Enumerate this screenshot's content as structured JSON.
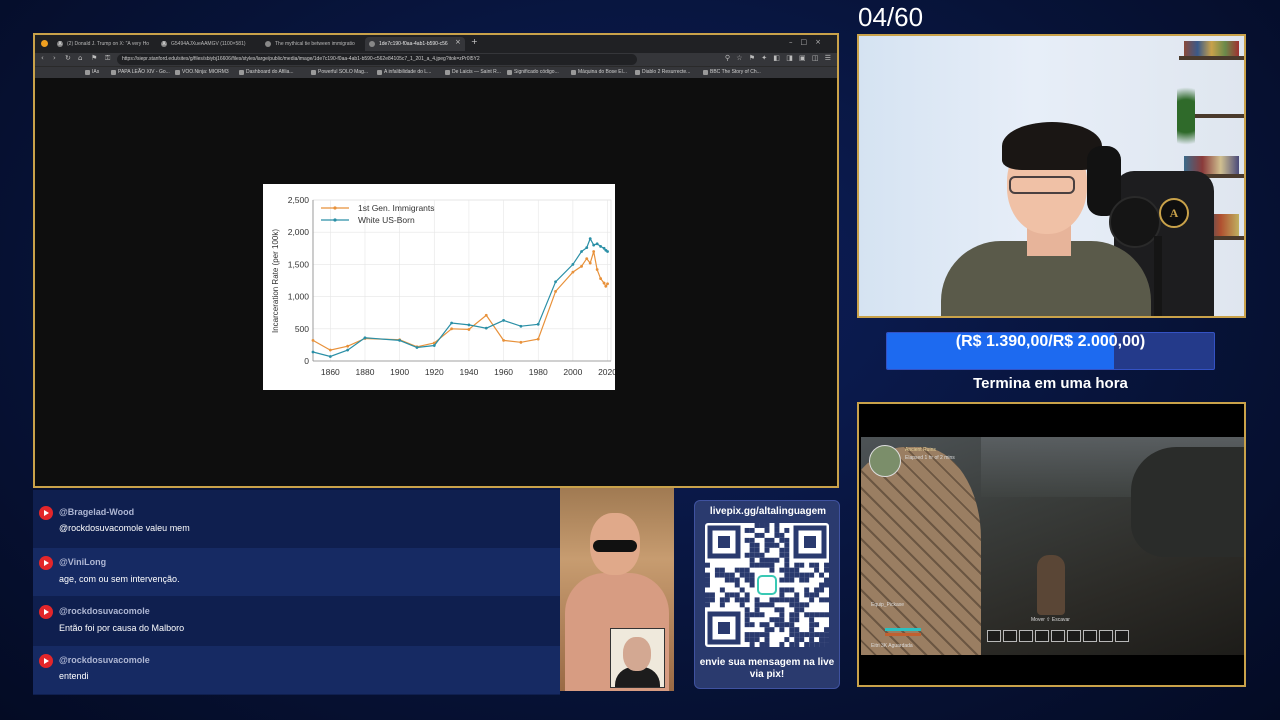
{
  "browser": {
    "tabs": [
      {
        "icon": "X",
        "label": "(2) Donald J. Trump on X: \"A very Ho"
      },
      {
        "icon": "X",
        "label": "G5494AJXueAAMGV (1100×581)"
      },
      {
        "icon": "",
        "label": "The mythical tie between immigratio"
      },
      {
        "icon": "",
        "label": "1de7c190-f0aa-4ab1-b590-c56"
      }
    ],
    "url": "https://siepr.stanford.edu/sites/g/files/sbiybj16606/files/styles/large/public/media/image/1de7c190-f0aa-4ab1-b590-c562e84105c7_1_201_a_4.jpeg?itok=zPr0l5Y2",
    "bookmarks": [
      "IAs",
      "PAPA LEÃO XIV - Go...",
      "VOO.Ninja: MIORM3",
      "Dashboard do Afilia...",
      "Powerful SOLO Mag...",
      "A infalibilidade do L...",
      "De Laicis — Saint R...",
      "Significado código...",
      "Máquina do Bose El...",
      "Diablo 2 Resurrecte...",
      "BBC The Story of Ch..."
    ]
  },
  "chart_data": {
    "type": "line",
    "xlabel": "",
    "ylabel": "Incarceration Rate (per 100k)",
    "xlim": [
      1850,
      2022
    ],
    "ylim": [
      0,
      2500
    ],
    "xticks": [
      "1860",
      "1880",
      "1900",
      "1920",
      "1940",
      "1960",
      "1980",
      "2000",
      "2020"
    ],
    "yticks": [
      "0",
      "500",
      "1,000",
      "1,500",
      "2,000",
      "2,500"
    ],
    "grid": true,
    "legend": "top-left",
    "series": [
      {
        "name": "1st Gen. Immigrants",
        "color": "#e8913a",
        "x": [
          1850,
          1860,
          1870,
          1880,
          1900,
          1910,
          1920,
          1930,
          1940,
          1950,
          1960,
          1970,
          1980,
          1990,
          2000,
          2005,
          2008,
          2010,
          2012,
          2014,
          2016,
          2018,
          2019,
          2020
        ],
        "y": [
          320,
          170,
          230,
          350,
          330,
          220,
          280,
          500,
          490,
          710,
          320,
          290,
          340,
          1080,
          1380,
          1470,
          1590,
          1520,
          1700,
          1420,
          1280,
          1210,
          1160,
          1200
        ]
      },
      {
        "name": "White US-Born",
        "color": "#2a8fa6",
        "x": [
          1850,
          1860,
          1870,
          1880,
          1900,
          1910,
          1920,
          1930,
          1940,
          1950,
          1960,
          1970,
          1980,
          1990,
          2000,
          2005,
          2008,
          2010,
          2012,
          2014,
          2016,
          2018,
          2019,
          2020
        ],
        "y": [
          140,
          70,
          170,
          360,
          320,
          210,
          240,
          590,
          560,
          510,
          630,
          540,
          570,
          1230,
          1500,
          1700,
          1760,
          1900,
          1800,
          1820,
          1780,
          1750,
          1720,
          1700
        ]
      }
    ]
  },
  "chat": {
    "messages": [
      {
        "user": "@Bragelad-Wood",
        "text": "@rockdosuvacomole valeu mem"
      },
      {
        "user": "@ViniLong",
        "text": "age, com ou sem intervenção."
      },
      {
        "user": "@rockdosuvacomole",
        "text": "Então foi por causa do Malboro"
      },
      {
        "user": "@rockdosuvacomole",
        "text": "entendi"
      }
    ]
  },
  "livepix": {
    "url": "livepix.gg/altalinguagem",
    "message": "envie sua mensagem na live via pix!"
  },
  "counter": "04/60",
  "goal": {
    "text": "(R$ 1.390,00/R$ 2.000,00)",
    "progress": 0.695,
    "subtitle": "Termina em uma hora"
  },
  "game": {
    "hud_location": "Ancient Ruins",
    "hud_hint": "Elapsed 1 hr of 2 mins",
    "hud_left": "Equip_Pickaxe",
    "hud_bottom": "Eitri 3K  Aguardada",
    "hud_center": "Mover ⇧ Escavar"
  },
  "colors": {
    "frame_gold": "#c9a24a",
    "goal_fill": "#1d6af0",
    "youtube_red": "#e3262a"
  }
}
